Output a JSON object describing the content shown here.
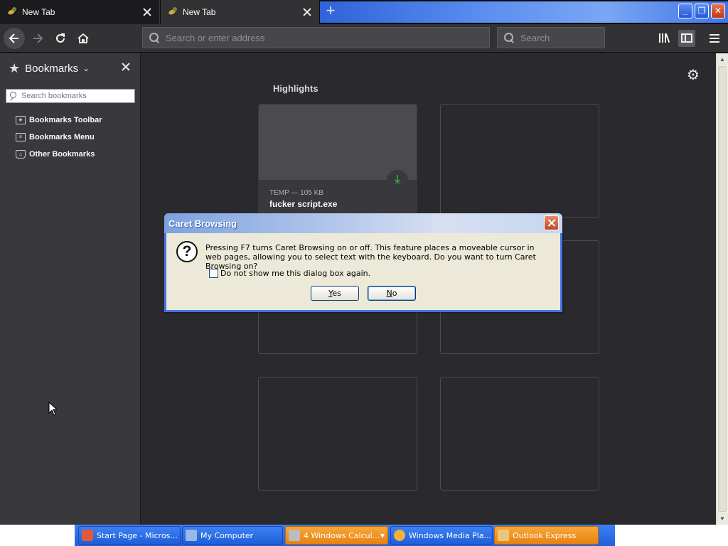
{
  "tabs": [
    {
      "label": "New Tab"
    },
    {
      "label": "New Tab"
    }
  ],
  "window": {
    "minimize": "_",
    "maximize": "❐",
    "close": "✕"
  },
  "navbar": {
    "address_placeholder": "Search or enter address",
    "search_placeholder": "Search"
  },
  "sidebar": {
    "title": "Bookmarks",
    "search_placeholder": "Search bookmarks",
    "items": [
      {
        "label": "Bookmarks Toolbar",
        "icon": "bookmarks-toolbar-icon"
      },
      {
        "label": "Bookmarks Menu",
        "icon": "bookmarks-menu-icon"
      },
      {
        "label": "Other Bookmarks",
        "icon": "other-bookmarks-icon"
      }
    ]
  },
  "newtab": {
    "section_title": "Highlights",
    "highlight": {
      "meta": "TEMP — 105 KB",
      "filename": "fucker script.exe"
    }
  },
  "dialog": {
    "title": "Caret Browsing",
    "message": "Pressing F7 turns Caret Browsing on or off. This feature places a moveable cursor in web pages, allowing you to select text with the keyboard. Do you want to turn Caret Browsing on?",
    "checkbox_label": "Do not show me this dialog box again.",
    "checkbox_checked": false,
    "yes_label": "Yes",
    "no_label": "No"
  },
  "taskbar": {
    "tasks": [
      {
        "label": "Start Page - Micros...",
        "icon_color": "#e05a3a"
      },
      {
        "label": "My Computer",
        "icon_color": "#9bb8e6"
      },
      {
        "label": "4 Windows Calcul...",
        "icon_color": "#bcbcbc"
      },
      {
        "label": "Windows Media Pla...",
        "icon_color": "#f2b233"
      },
      {
        "label": "Outlook Express",
        "icon_color": "#e9c77a"
      }
    ]
  }
}
